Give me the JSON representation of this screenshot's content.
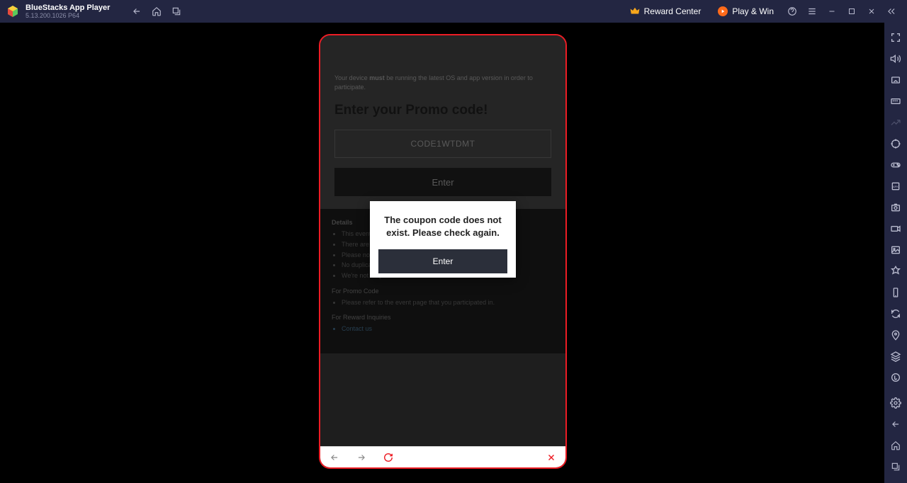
{
  "header": {
    "app_title": "BlueStacks App Player",
    "app_version": "5.13.200.1026  P64",
    "reward_center": "Reward Center",
    "play_win": "Play & Win"
  },
  "phone": {
    "note_prefix": "Your device ",
    "note_must": "must",
    "note_suffix": " be running the latest OS and app version in order to participate.",
    "heading": "Enter your Promo code!",
    "code_value": "CODE1WTDMT",
    "enter_label": "Enter",
    "details": {
      "heading": "Details",
      "items": [
        "This event is subject to change based on the circumstances.",
        "There are no refunds once you enter the code.",
        "Please note the valid period of the event.",
        "No duplicate usage of the codes.",
        "We're not responsible for user errors."
      ],
      "promo_heading": "For Promo Code",
      "promo_items": [
        "Please refer to the event page that you participated in."
      ],
      "reward_heading": "For Reward Inquiries",
      "contact": "Contact us"
    }
  },
  "dialog": {
    "message": "The coupon code does not exist. Please check again.",
    "button": "Enter"
  }
}
